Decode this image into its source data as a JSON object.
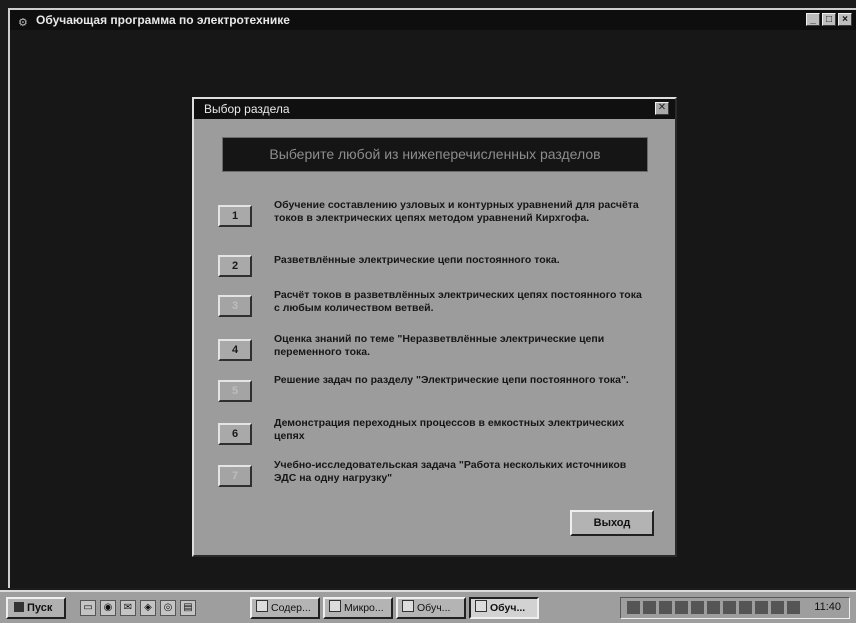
{
  "main_window": {
    "title": "Обучающая программа по электротехнике",
    "controls": [
      "_",
      "□",
      "×"
    ]
  },
  "dialog": {
    "title": "Выбор раздела",
    "header": "Выберите любой из нижеперечисленных разделов",
    "sections": [
      {
        "number": "1",
        "text": "Обучение составлению узловых и контурных уравнений для расчёта токов в электрических цепях методом уравнений Кирхгофа."
      },
      {
        "number": "2",
        "text": "Разветвлённые электрические цепи постоянного тока."
      },
      {
        "number": "3",
        "text": "Расчёт токов в разветвлённых электрических цепях постоянного тока с любым количеством ветвей."
      },
      {
        "number": "4",
        "text": "Оценка знаний по теме \"Неразветвлённые электрические цепи переменного тока."
      },
      {
        "number": "5",
        "text": "Решение задач по разделу \"Электрические цепи постоянного тока\"."
      },
      {
        "number": "6",
        "text": "Демонстрация переходных процессов в емкостных электрических цепях"
      },
      {
        "number": "7",
        "text": "Учебно-исследовательская задача \"Работа нескольких источников ЭДС на одну нагрузку\""
      }
    ],
    "exit_label": "Выход"
  },
  "taskbar": {
    "start_label": "Пуск",
    "tasks": [
      "Содер...",
      "Микро...",
      "Обуч...",
      "Обуч..."
    ],
    "clock": "11:40"
  }
}
